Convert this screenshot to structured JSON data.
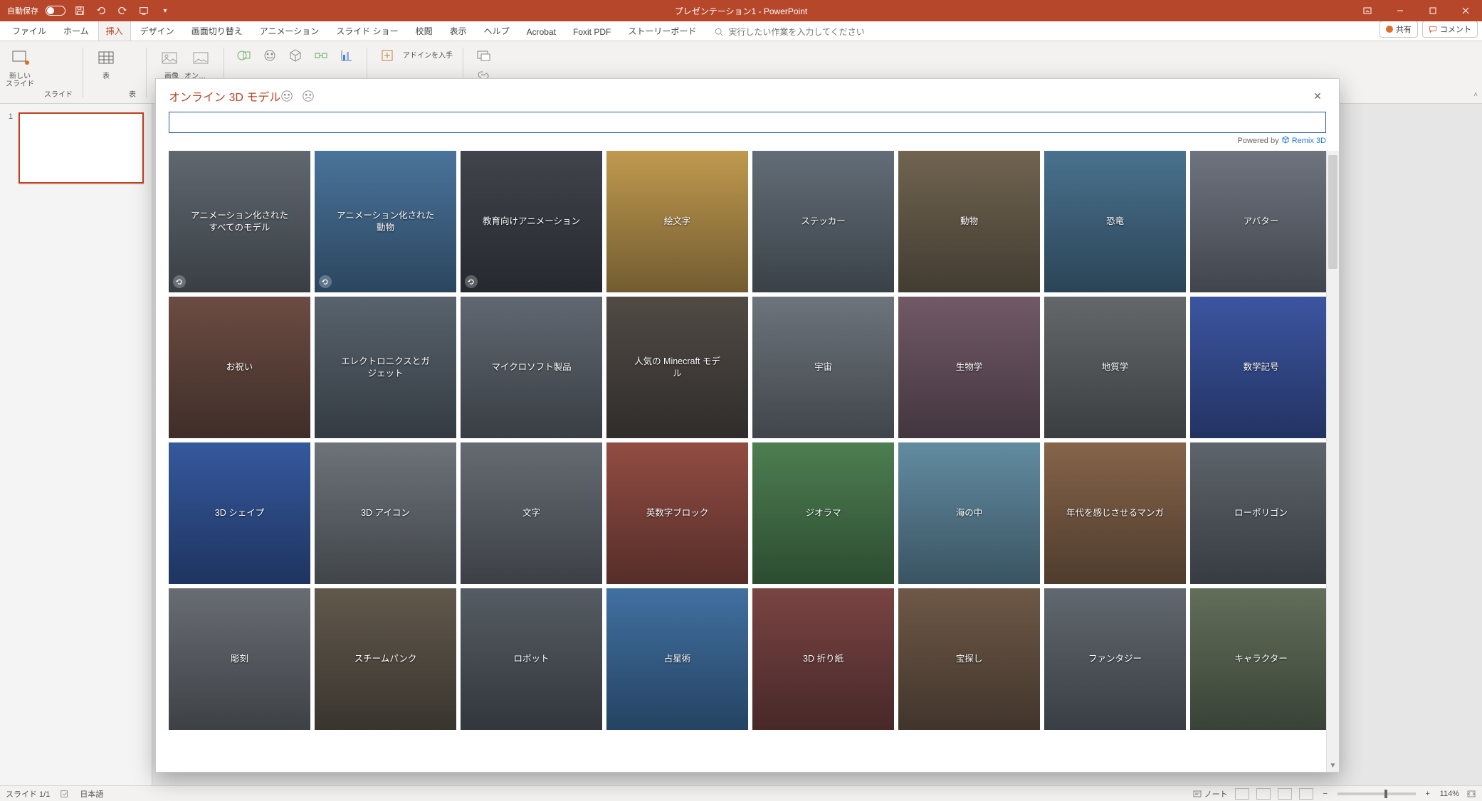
{
  "titlebar": {
    "autosave_label": "自動保存",
    "autosave_state": "オフ",
    "title": "プレゼンテーション1 - PowerPoint"
  },
  "tabs": {
    "items": [
      "ファイル",
      "ホーム",
      "挿入",
      "デザイン",
      "画面切り替え",
      "アニメーション",
      "スライド ショー",
      "校閲",
      "表示",
      "ヘルプ",
      "Acrobat",
      "Foxit PDF",
      "ストーリーボード"
    ],
    "active_index": 2,
    "tellme_placeholder": "実行したい作業を入力してください",
    "share_label": "共有",
    "comments_label": "コメント"
  },
  "ribbon": {
    "groups": {
      "slides": {
        "new_slide": "新しい\nスライド",
        "label": "スライド"
      },
      "tables": {
        "table": "表",
        "label": "表"
      },
      "images": {
        "image": "画像",
        "online": "オン…"
      },
      "addins": {
        "get": "アドインを入手"
      }
    }
  },
  "thumbnails": {
    "items": [
      {
        "index": "1"
      }
    ]
  },
  "statusbar": {
    "slide_indicator": "スライド 1/1",
    "language": "日本語",
    "notes_label": "ノート",
    "zoom_pct": "114%"
  },
  "dialog": {
    "title": "オンライン 3D モデル",
    "search_placeholder": "",
    "search_value": "",
    "powered_by_prefix": "Powered by ",
    "powered_by_service": "Remix 3D",
    "categories": [
      {
        "label": "アニメーション化された\nすべてのモデル",
        "anim": true,
        "bg": 0
      },
      {
        "label": "アニメーション化された\n動物",
        "anim": true,
        "bg": 1
      },
      {
        "label": "教育向けアニメーション",
        "anim": true,
        "bg": 2
      },
      {
        "label": "絵文字",
        "anim": false,
        "bg": 3
      },
      {
        "label": "ステッカー",
        "anim": false,
        "bg": 4
      },
      {
        "label": "動物",
        "anim": false,
        "bg": 5
      },
      {
        "label": "恐竜",
        "anim": false,
        "bg": 6
      },
      {
        "label": "アバター",
        "anim": false,
        "bg": 7
      },
      {
        "label": "お祝い",
        "anim": false,
        "bg": 8
      },
      {
        "label": "エレクトロニクスとガ\nジェット",
        "anim": false,
        "bg": 9
      },
      {
        "label": "マイクロソフト製品",
        "anim": false,
        "bg": 10
      },
      {
        "label": "人気の Minecraft モデ\nル",
        "anim": false,
        "bg": 11
      },
      {
        "label": "宇宙",
        "anim": false,
        "bg": 12
      },
      {
        "label": "生物学",
        "anim": false,
        "bg": 13
      },
      {
        "label": "地質学",
        "anim": false,
        "bg": 14
      },
      {
        "label": "数学記号",
        "anim": false,
        "bg": 15
      },
      {
        "label": "3D シェイプ",
        "anim": false,
        "bg": 16
      },
      {
        "label": "3D アイコン",
        "anim": false,
        "bg": 17
      },
      {
        "label": "文字",
        "anim": false,
        "bg": 18
      },
      {
        "label": "英数字ブロック",
        "anim": false,
        "bg": 19
      },
      {
        "label": "ジオラマ",
        "anim": false,
        "bg": 20
      },
      {
        "label": "海の中",
        "anim": false,
        "bg": 21
      },
      {
        "label": "年代を感じさせるマンガ",
        "anim": false,
        "bg": 22
      },
      {
        "label": "ローポリゴン",
        "anim": false,
        "bg": 23
      },
      {
        "label": "彫刻",
        "anim": false,
        "bg": 24
      },
      {
        "label": "スチームパンク",
        "anim": false,
        "bg": 25
      },
      {
        "label": "ロボット",
        "anim": false,
        "bg": 26
      },
      {
        "label": "占星術",
        "anim": false,
        "bg": 27
      },
      {
        "label": "3D 折り紙",
        "anim": false,
        "bg": 28
      },
      {
        "label": "宝探し",
        "anim": false,
        "bg": 29
      },
      {
        "label": "ファンタジー",
        "anim": false,
        "bg": 30
      },
      {
        "label": "キャラクター",
        "anim": false,
        "bg": 31
      }
    ]
  }
}
